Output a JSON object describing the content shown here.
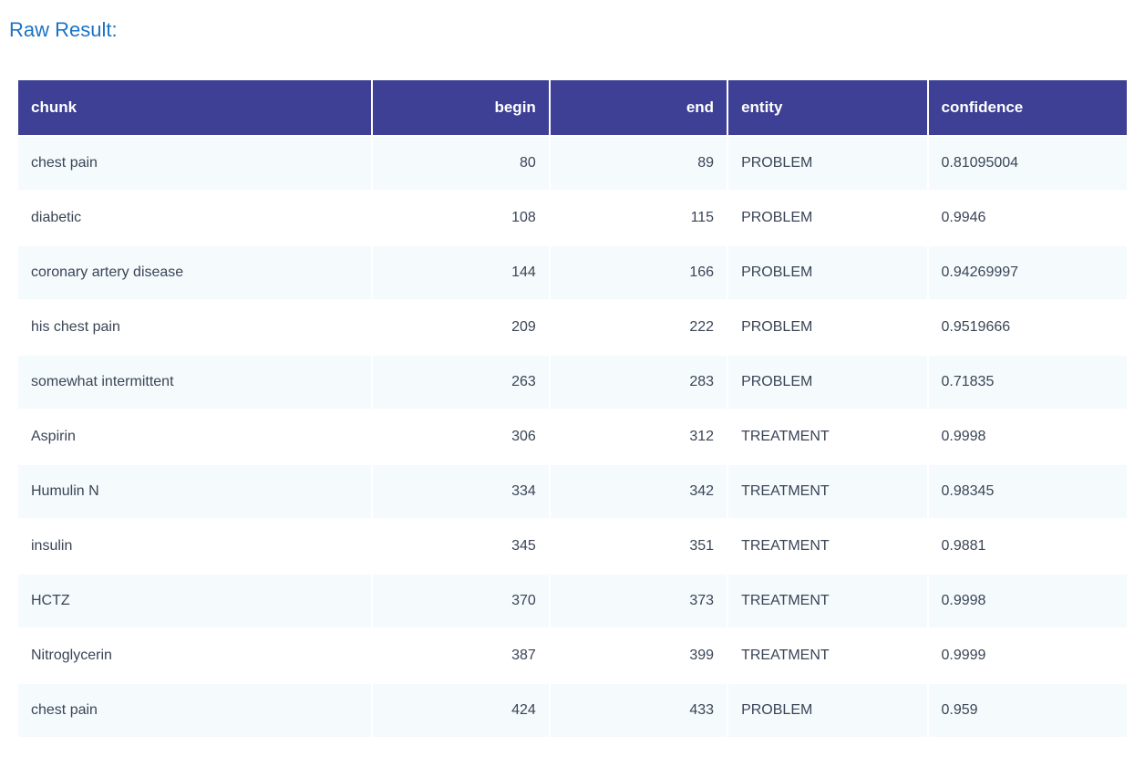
{
  "title": "Raw Result:",
  "headers": {
    "chunk": "chunk",
    "begin": "begin",
    "end": "end",
    "entity": "entity",
    "confidence": "confidence"
  },
  "rows": [
    {
      "chunk": "chest pain",
      "begin": "80",
      "end": "89",
      "entity": "PROBLEM",
      "confidence": "0.81095004"
    },
    {
      "chunk": "diabetic",
      "begin": "108",
      "end": "115",
      "entity": "PROBLEM",
      "confidence": "0.9946"
    },
    {
      "chunk": "coronary artery disease",
      "begin": "144",
      "end": "166",
      "entity": "PROBLEM",
      "confidence": "0.94269997"
    },
    {
      "chunk": "his chest pain",
      "begin": "209",
      "end": "222",
      "entity": "PROBLEM",
      "confidence": "0.9519666"
    },
    {
      "chunk": "somewhat intermittent",
      "begin": "263",
      "end": "283",
      "entity": "PROBLEM",
      "confidence": "0.71835"
    },
    {
      "chunk": "Aspirin",
      "begin": "306",
      "end": "312",
      "entity": "TREATMENT",
      "confidence": "0.9998"
    },
    {
      "chunk": "Humulin N",
      "begin": "334",
      "end": "342",
      "entity": "TREATMENT",
      "confidence": "0.98345"
    },
    {
      "chunk": "insulin",
      "begin": "345",
      "end": "351",
      "entity": "TREATMENT",
      "confidence": "0.9881"
    },
    {
      "chunk": "HCTZ",
      "begin": "370",
      "end": "373",
      "entity": "TREATMENT",
      "confidence": "0.9998"
    },
    {
      "chunk": "Nitroglycerin",
      "begin": "387",
      "end": "399",
      "entity": "TREATMENT",
      "confidence": "0.9999"
    },
    {
      "chunk": "chest pain",
      "begin": "424",
      "end": "433",
      "entity": "PROBLEM",
      "confidence": "0.959"
    }
  ]
}
